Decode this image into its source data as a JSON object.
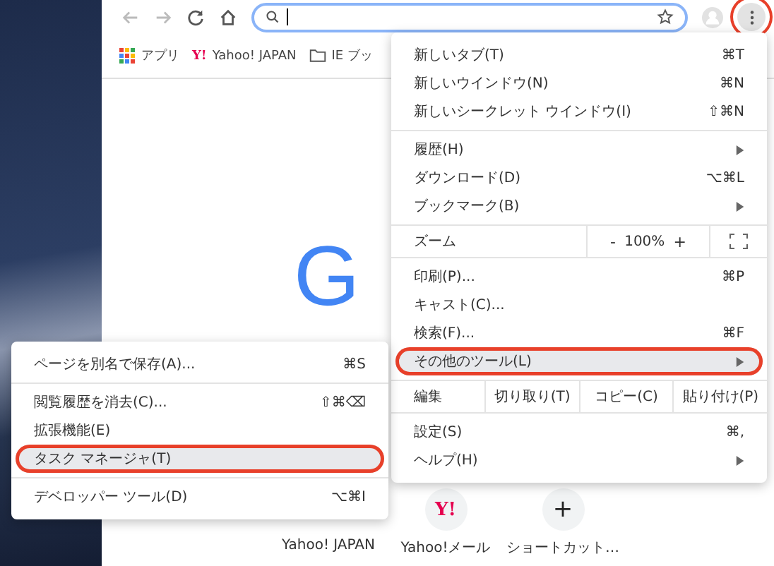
{
  "toolbar": {
    "menu_button": {
      "open": true,
      "annotated": true
    }
  },
  "bookmarks": [
    {
      "kind": "apps",
      "label": "アプリ"
    },
    {
      "kind": "site",
      "icon_text": "Y!",
      "label": "Yahoo! JAPAN"
    },
    {
      "kind": "folder",
      "label": "IE ブッ"
    }
  ],
  "logo_text": "G",
  "shortcuts": [
    {
      "label": "Yahoo! JAPAN"
    },
    {
      "icon_text": "Y!",
      "label": "Yahoo!メール"
    },
    {
      "icon_text": "+",
      "label": "ショートカット…"
    }
  ],
  "main_menu": [
    {
      "kind": "item",
      "label": "新しいタブ(T)",
      "shortcut": "⌘T",
      "submenu": false,
      "selected": false,
      "annotated": false
    },
    {
      "kind": "item",
      "label": "新しいウインドウ(N)",
      "shortcut": "⌘N",
      "submenu": false,
      "selected": false,
      "annotated": false
    },
    {
      "kind": "item",
      "label": "新しいシークレット ウインドウ(I)",
      "shortcut": "⇧⌘N",
      "submenu": false,
      "selected": false,
      "annotated": false
    },
    {
      "kind": "separator"
    },
    {
      "kind": "item",
      "label": "履歴(H)",
      "submenu": true,
      "selected": false,
      "annotated": false
    },
    {
      "kind": "item",
      "label": "ダウンロード(D)",
      "shortcut": "⌥⌘L",
      "submenu": false,
      "selected": false,
      "annotated": false
    },
    {
      "kind": "item",
      "label": "ブックマーク(B)",
      "submenu": true,
      "selected": false,
      "annotated": false
    },
    {
      "kind": "zoom",
      "label": "ズーム",
      "minus": "-",
      "value": "100%",
      "plus": "+"
    },
    {
      "kind": "item",
      "label": "印刷(P)...",
      "shortcut": "⌘P",
      "submenu": false,
      "selected": false,
      "annotated": false
    },
    {
      "kind": "item",
      "label": "キャスト(C)...",
      "submenu": false,
      "selected": false,
      "annotated": false
    },
    {
      "kind": "item",
      "label": "検索(F)...",
      "shortcut": "⌘F",
      "submenu": false,
      "selected": false,
      "annotated": false
    },
    {
      "kind": "item",
      "label": "その他のツール(L)",
      "submenu": true,
      "selected": true,
      "annotated": true
    },
    {
      "kind": "edit",
      "label": "編集",
      "buttons": [
        "切り取り(T)",
        "コピー(C)",
        "貼り付け(P)"
      ]
    },
    {
      "kind": "item",
      "label": "設定(S)",
      "shortcut": "⌘,",
      "submenu": false,
      "selected": false,
      "annotated": false
    },
    {
      "kind": "item",
      "label": "ヘルプ(H)",
      "submenu": true,
      "selected": false,
      "annotated": false
    }
  ],
  "sub_menu": [
    {
      "kind": "item",
      "label": "ページを別名で保存(A)...",
      "shortcut": "⌘S",
      "selected": false,
      "annotated": false
    },
    {
      "kind": "separator"
    },
    {
      "kind": "item",
      "label": "閲覧履歴を消去(C)...",
      "shortcut": "⇧⌘⌫",
      "selected": false,
      "annotated": false
    },
    {
      "kind": "item",
      "label": "拡張機能(E)",
      "selected": false,
      "annotated": false
    },
    {
      "kind": "item",
      "label": "タスク マネージャ(T)",
      "selected": true,
      "annotated": true
    },
    {
      "kind": "separator"
    },
    {
      "kind": "item",
      "label": "デベロッパー ツール(D)",
      "shortcut": "⌥⌘I",
      "selected": false,
      "annotated": false
    }
  ]
}
